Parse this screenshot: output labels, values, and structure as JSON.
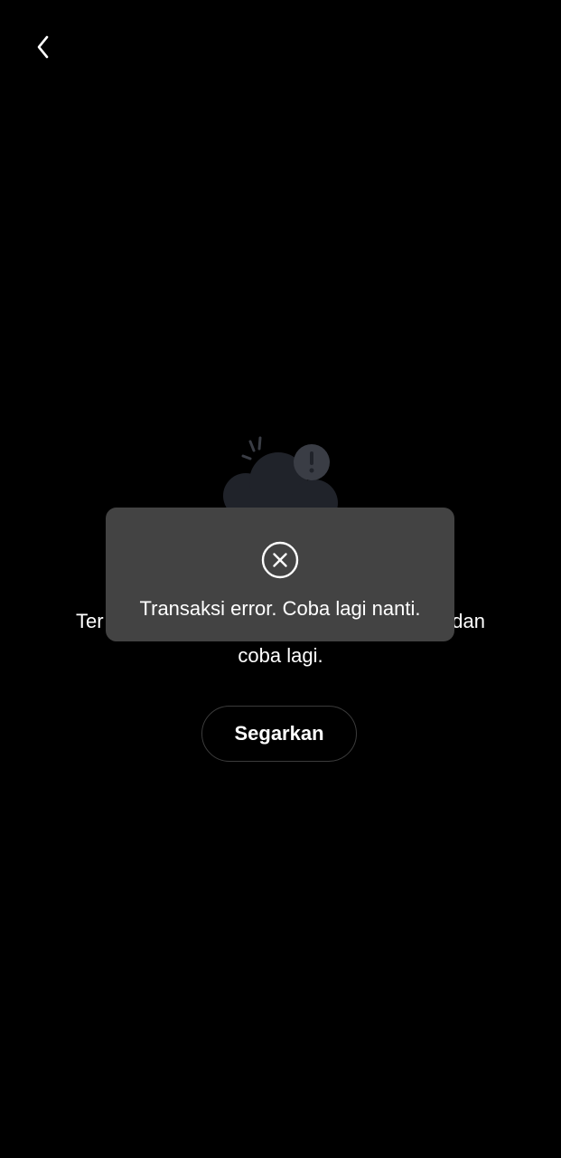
{
  "header": {
    "back_icon": "chevron-left-icon"
  },
  "empty_state": {
    "illustration": "cloud-alert-icon",
    "message_visible_left": "Ter",
    "message_visible_right": "dan",
    "message_line2": "coba lagi.",
    "refresh_label": "Segarkan"
  },
  "toast": {
    "icon": "close-circle-icon",
    "text": "Transaksi error. Coba lagi nanti."
  },
  "colors": {
    "background": "#000000",
    "toast_background": "#434343",
    "illustration_fill": "#20232a",
    "button_border": "#3c3c3c"
  }
}
